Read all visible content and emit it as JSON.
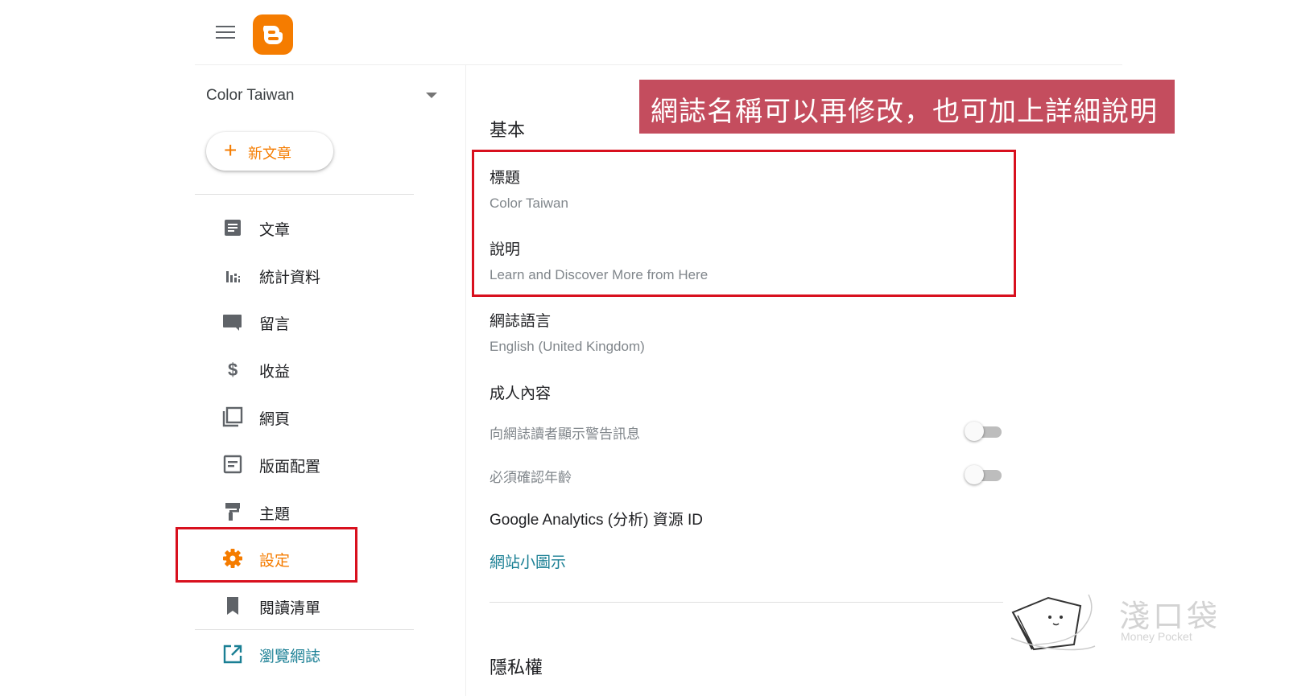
{
  "header": {
    "menu_icon": "hamburger-menu-icon",
    "logo_icon": "blogger-logo-icon",
    "brand_color": "#f57c00"
  },
  "sidebar": {
    "blog_name": "Color Taiwan",
    "new_post_label": "新文章",
    "items": [
      {
        "label": "文章",
        "icon": "posts-icon"
      },
      {
        "label": "統計資料",
        "icon": "stats-icon"
      },
      {
        "label": "留言",
        "icon": "comments-icon"
      },
      {
        "label": "收益",
        "icon": "earnings-icon"
      },
      {
        "label": "網頁",
        "icon": "pages-icon"
      },
      {
        "label": "版面配置",
        "icon": "layout-icon"
      },
      {
        "label": "主題",
        "icon": "theme-icon"
      },
      {
        "label": "設定",
        "icon": "settings-gear-icon",
        "active": true
      },
      {
        "label": "閱讀清單",
        "icon": "reading-list-icon"
      },
      {
        "label": "瀏覽網誌",
        "icon": "view-blog-icon"
      }
    ]
  },
  "annotation": {
    "text": "網誌名稱可以再修改，也可加上詳細說明",
    "color": "#c44d5e"
  },
  "main": {
    "section_basic": "基本",
    "title_label": "標題",
    "title_value": "Color Taiwan",
    "description_label": "說明",
    "description_value": "Learn and Discover More from Here",
    "language_label": "網誌語言",
    "language_value": "English (United Kingdom)",
    "adult_label": "成人內容",
    "adult_warning_label": "向網誌讀者顯示警告訊息",
    "adult_warning_on": false,
    "age_check_label": "必須確認年齡",
    "age_check_on": false,
    "analytics_label": "Google Analytics (分析) 資源 ID",
    "favicon_label": "網站小圖示",
    "section_privacy": "隱私權"
  },
  "watermark": {
    "title": "淺口袋",
    "subtitle": "Money Pocket"
  },
  "highlight_color": "#d8101e"
}
